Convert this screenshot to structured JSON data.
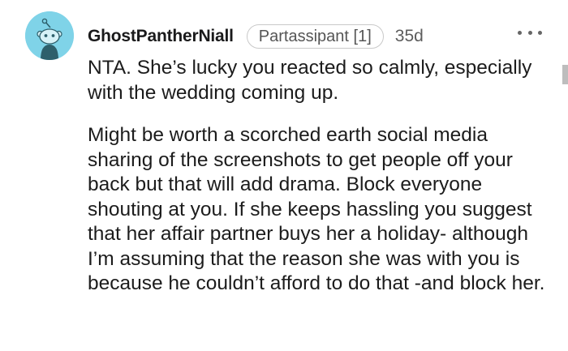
{
  "comment": {
    "author": "GhostPantherNiall",
    "flair": "Partassipant [1]",
    "age": "35d",
    "paragraphs": [
      "NTA. She’s lucky you reacted so calmly, especially with the wedding coming up.",
      "Might be worth a scorched earth social media sharing of the screenshots to get people off your back but that will add drama. Block everyone shouting at you. If she keeps hassling you suggest that her affair partner buys her a holiday- although I’m assuming that the reason she was with you is because he couldn’t afford to do that -and block her."
    ]
  },
  "icons": {
    "avatar": "snoo-avatar",
    "more": "more-options-icon"
  },
  "colors": {
    "avatar_bg": "#7fd3e8",
    "text": "#1c1c1c",
    "meta": "#5c5c5c",
    "flair_border": "#c9c9c9"
  }
}
